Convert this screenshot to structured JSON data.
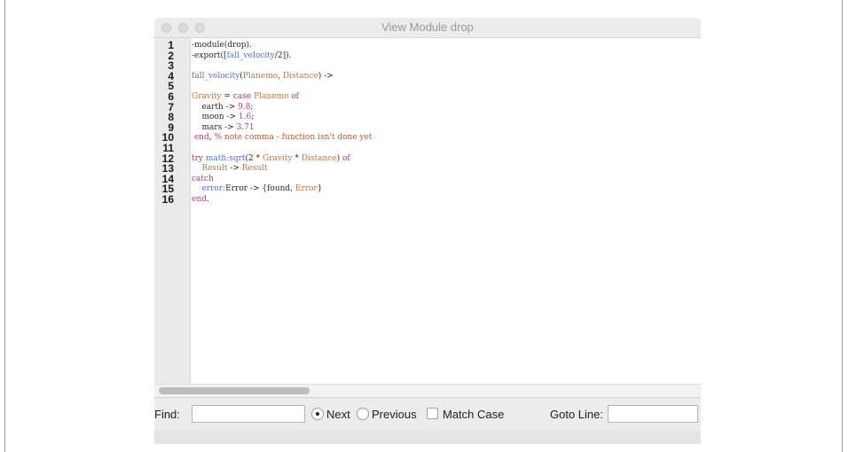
{
  "window": {
    "title": "View Module drop"
  },
  "editor": {
    "line_numbers": [
      "1",
      "2",
      "3",
      "4",
      "5",
      "6",
      "7",
      "8",
      "9",
      "10",
      "11",
      "12",
      "13",
      "14",
      "15",
      "16"
    ],
    "lines": [
      {
        "segments": [
          {
            "t": "-module(drop).",
            "c": "plain"
          }
        ]
      },
      {
        "segments": [
          {
            "t": "-export([",
            "c": "plain"
          },
          {
            "t": "fall_velocity",
            "c": "fn"
          },
          {
            "t": "/2",
            "c": "plain"
          },
          {
            "t": "]).",
            "c": "plain"
          }
        ]
      },
      {
        "segments": []
      },
      {
        "segments": [
          {
            "t": "fall_velocity",
            "c": "fn"
          },
          {
            "t": "(",
            "c": "plain"
          },
          {
            "t": "Planemo",
            "c": "var"
          },
          {
            "t": ", ",
            "c": "plain"
          },
          {
            "t": "Distance",
            "c": "var"
          },
          {
            "t": ") ->",
            "c": "plain"
          }
        ]
      },
      {
        "segments": []
      },
      {
        "segments": [
          {
            "t": "Gravity",
            "c": "var"
          },
          {
            "t": " = ",
            "c": "plain"
          },
          {
            "t": "case",
            "c": "kw"
          },
          {
            "t": " ",
            "c": "plain"
          },
          {
            "t": "Planemo",
            "c": "var"
          },
          {
            "t": " of",
            "c": "kw"
          }
        ]
      },
      {
        "segments": [
          {
            "t": "    earth -> ",
            "c": "plain"
          },
          {
            "t": "9.8",
            "c": "num"
          },
          {
            "t": ";",
            "c": "plain"
          }
        ]
      },
      {
        "segments": [
          {
            "t": "    moon -> ",
            "c": "plain"
          },
          {
            "t": "1.6",
            "c": "num"
          },
          {
            "t": ";",
            "c": "plain"
          }
        ]
      },
      {
        "segments": [
          {
            "t": "    mars -> ",
            "c": "plain"
          },
          {
            "t": "3.71",
            "c": "num"
          }
        ]
      },
      {
        "segments": [
          {
            "t": " end",
            "c": "kw"
          },
          {
            "t": ", ",
            "c": "plain"
          },
          {
            "t": "% note comma - function isn't done yet",
            "c": "cm"
          }
        ]
      },
      {
        "segments": []
      },
      {
        "segments": [
          {
            "t": "try",
            "c": "kw"
          },
          {
            "t": " ",
            "c": "plain"
          },
          {
            "t": "math:sqrt",
            "c": "fn"
          },
          {
            "t": "(2 * ",
            "c": "plain"
          },
          {
            "t": "Gravity",
            "c": "var"
          },
          {
            "t": " * ",
            "c": "plain"
          },
          {
            "t": "Distance",
            "c": "var"
          },
          {
            "t": ") ",
            "c": "plain"
          },
          {
            "t": "of",
            "c": "kw"
          }
        ]
      },
      {
        "segments": [
          {
            "t": "    ",
            "c": "plain"
          },
          {
            "t": "Result",
            "c": "var"
          },
          {
            "t": " -> ",
            "c": "plain"
          },
          {
            "t": "Result",
            "c": "var"
          }
        ]
      },
      {
        "segments": [
          {
            "t": "catch",
            "c": "kw"
          }
        ]
      },
      {
        "segments": [
          {
            "t": "    ",
            "c": "plain"
          },
          {
            "t": "error:",
            "c": "fn"
          },
          {
            "t": "Error -> {found, ",
            "c": "plain"
          },
          {
            "t": "Error",
            "c": "var"
          },
          {
            "t": "}",
            "c": "plain"
          }
        ]
      },
      {
        "segments": [
          {
            "t": "end",
            "c": "kw"
          },
          {
            "t": ".",
            "c": "plain"
          }
        ]
      }
    ]
  },
  "findbar": {
    "find_label": "Find:",
    "find_value": "",
    "next_label": "Next",
    "previous_label": "Previous",
    "match_case_label": "Match Case",
    "goto_label": "Goto Line:",
    "goto_value": "",
    "selected_direction": "Next"
  }
}
